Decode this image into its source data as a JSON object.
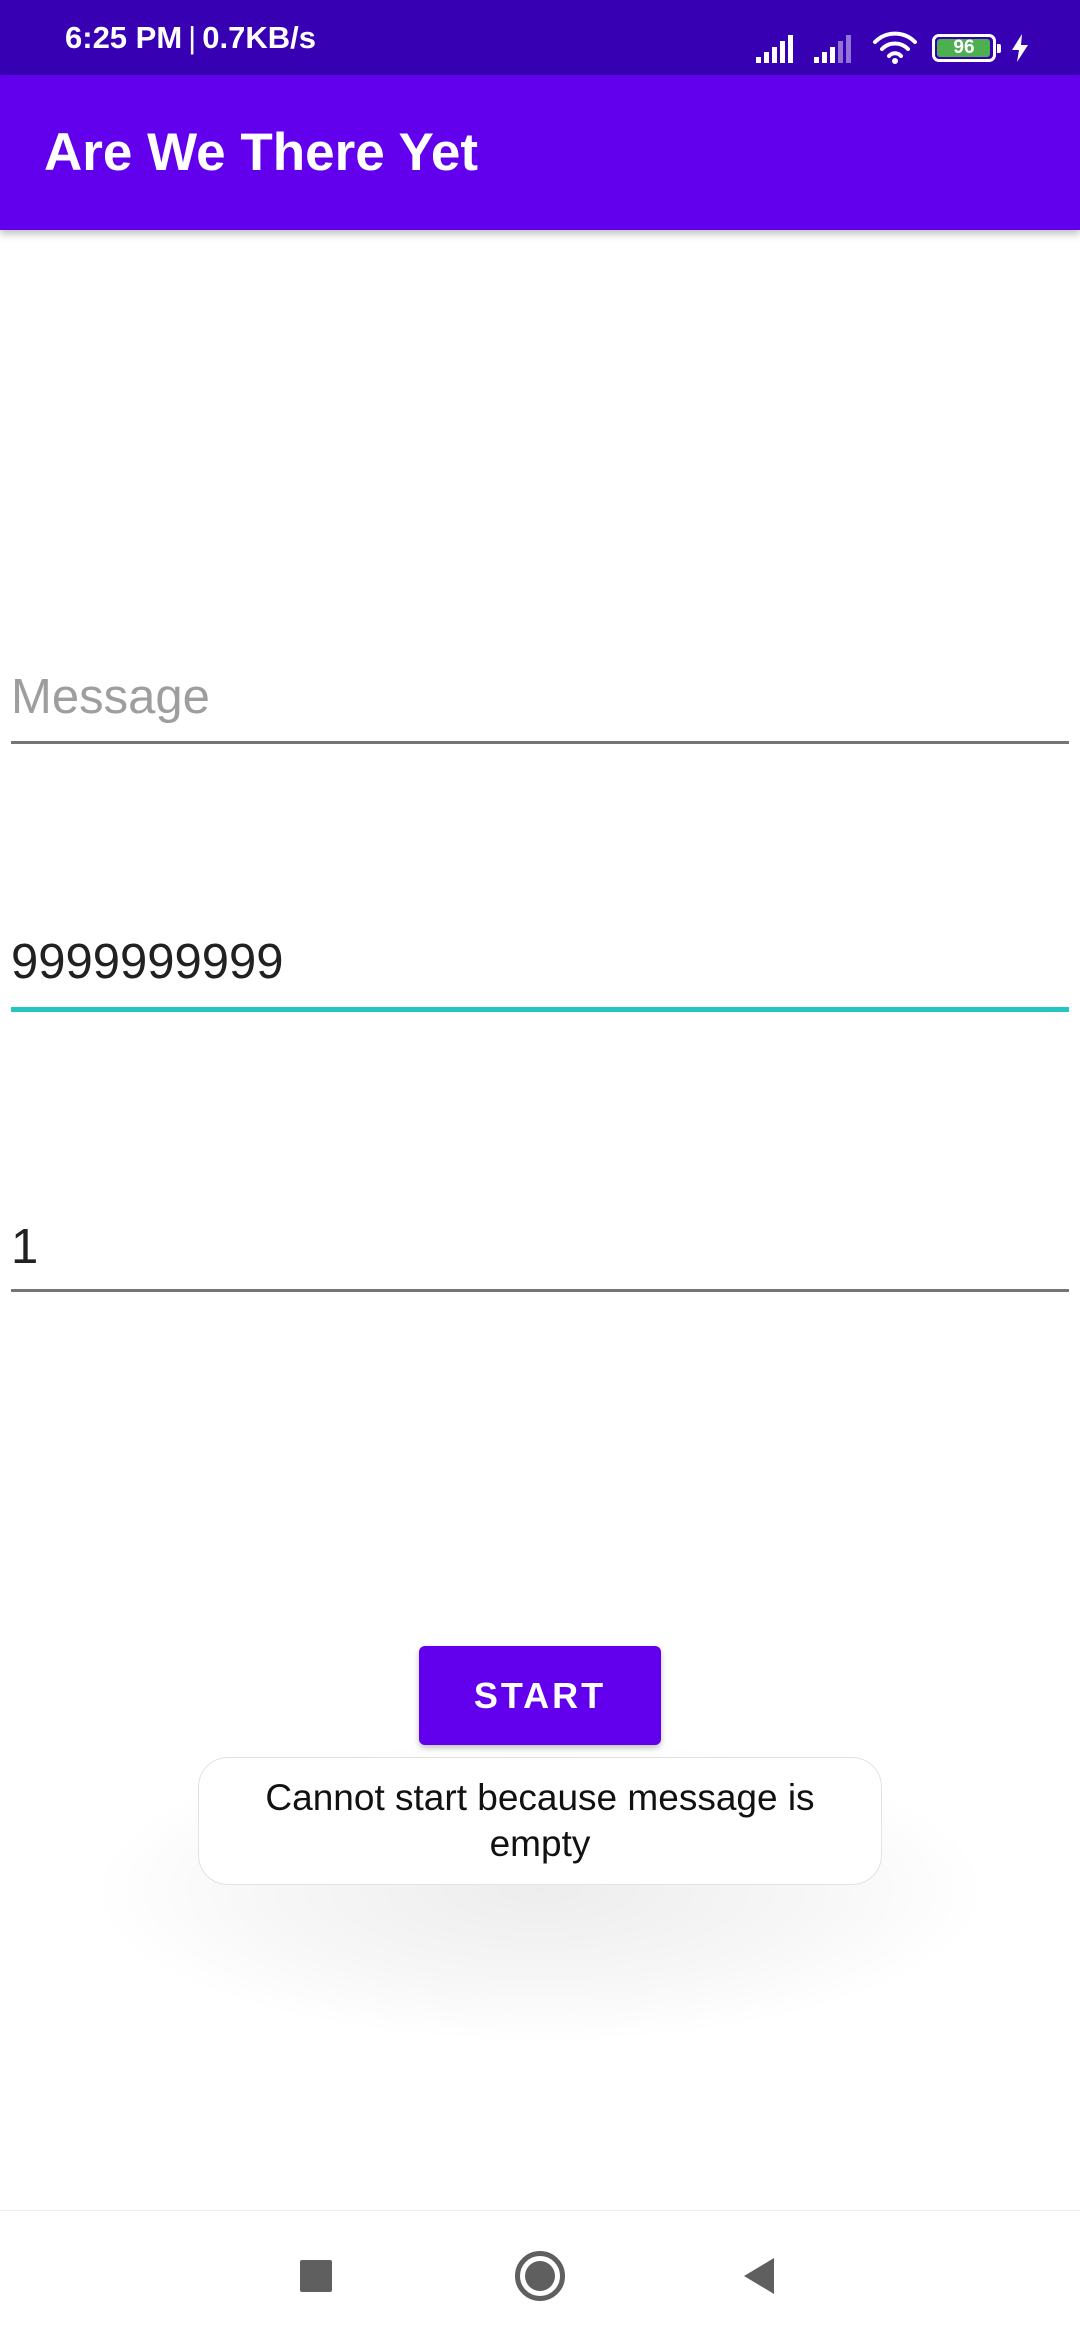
{
  "status_bar": {
    "time": "6:25 PM",
    "separator": "|",
    "network_speed": "0.7KB/s",
    "battery_level": "96",
    "icons": [
      "signal-icon",
      "signal-icon",
      "wifi-icon",
      "battery-icon",
      "charging-icon"
    ],
    "background": "#3700b3"
  },
  "app_bar": {
    "title": "Are We There Yet",
    "background": "#6200ee"
  },
  "form": {
    "message": {
      "value": "",
      "placeholder": "Message"
    },
    "phone": {
      "value": "9999999999",
      "focused": true
    },
    "interval": {
      "value": "1"
    },
    "start_label": "START"
  },
  "toast": {
    "text": "Cannot start because message is empty"
  },
  "nav_bar": {
    "icons": [
      "recents-icon",
      "home-icon",
      "back-icon"
    ]
  },
  "colors": {
    "primary": "#6200ee",
    "primary_dark": "#3700b3",
    "focus_accent": "#26c6c0"
  }
}
